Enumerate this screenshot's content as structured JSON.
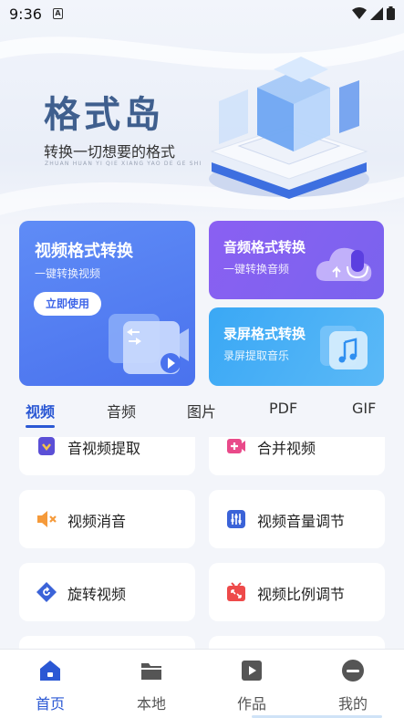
{
  "status_bar": {
    "time": "9:36",
    "notification_icon": "A"
  },
  "brand": {
    "title": "格式岛",
    "subtitle": "转换一切想要的格式",
    "pinyin": "ZHUAN HUAN YI QIE XIANG YAO DE GE SHI"
  },
  "feature_cards": {
    "video": {
      "title": "视频格式转换",
      "subtitle": "一键转换视频",
      "button": "立即使用"
    },
    "audio": {
      "title": "音频格式转换",
      "subtitle": "一键转换音频"
    },
    "screen": {
      "title": "录屏格式转换",
      "subtitle": "录屏提取音乐"
    }
  },
  "tabs": [
    "视频",
    "音频",
    "图片",
    "PDF",
    "GIF"
  ],
  "active_tab": "视频",
  "tools": [
    {
      "label": "音视频提取",
      "icon": "extract-icon",
      "color": "#5b4fd6"
    },
    {
      "label": "合并视频",
      "icon": "merge-video-icon",
      "color": "#e94a8a"
    },
    {
      "label": "视频消音",
      "icon": "mute-icon",
      "color": "#f59a3a"
    },
    {
      "label": "视频音量调节",
      "icon": "volume-adjust-icon",
      "color": "#3b63d8"
    },
    {
      "label": "旋转视频",
      "icon": "rotate-icon",
      "color": "#3b63d8"
    },
    {
      "label": "视频比例调节",
      "icon": "ratio-icon",
      "color": "#ee4a4a"
    }
  ],
  "bottom_nav": [
    {
      "label": "首页",
      "icon": "home-icon",
      "active": true
    },
    {
      "label": "本地",
      "icon": "folder-icon",
      "active": false
    },
    {
      "label": "作品",
      "icon": "play-icon",
      "active": false
    },
    {
      "label": "我的",
      "icon": "profile-icon",
      "active": false
    }
  ],
  "colors": {
    "accent": "#2b58d4",
    "video_card": "#4a72ee",
    "audio_card": "#7a63ee",
    "screen_card": "#3aa8f5"
  }
}
